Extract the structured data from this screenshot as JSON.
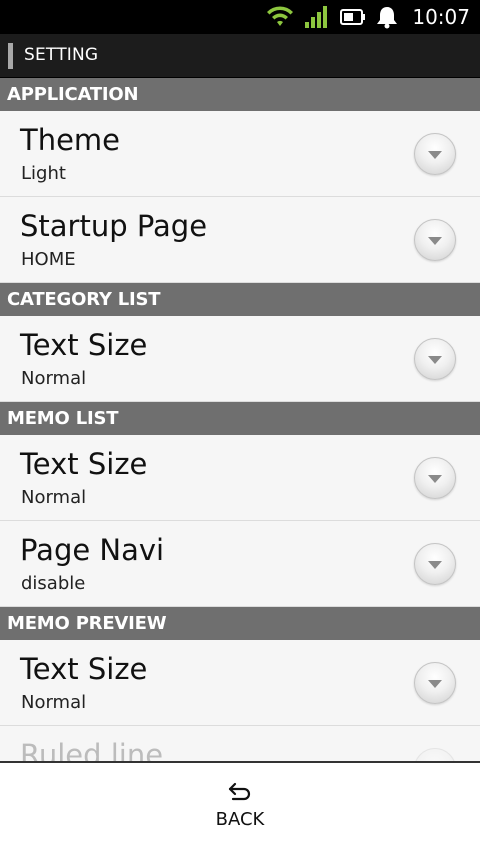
{
  "status_bar": {
    "time": "10:07",
    "icons": [
      "wifi-icon",
      "signal-icon",
      "battery-icon",
      "bell-icon"
    ],
    "wifi_color": "#8dc63f",
    "signal_color": "#8dc63f"
  },
  "header": {
    "title": "SETTING"
  },
  "sections": [
    {
      "label": "APPLICATION",
      "rows": [
        {
          "title": "Theme",
          "value": "Light"
        },
        {
          "title": "Startup Page",
          "value": "HOME"
        }
      ]
    },
    {
      "label": "CATEGORY LIST",
      "rows": [
        {
          "title": "Text Size",
          "value": "Normal"
        }
      ]
    },
    {
      "label": "MEMO LIST",
      "rows": [
        {
          "title": "Text Size",
          "value": "Normal"
        },
        {
          "title": "Page Navi",
          "value": "disable"
        }
      ]
    },
    {
      "label": "MEMO PREVIEW",
      "rows": [
        {
          "title": "Text Size",
          "value": "Normal"
        },
        {
          "title": "Ruled line",
          "value": ""
        }
      ]
    }
  ],
  "footer": {
    "back_label": "BACK"
  },
  "colors": {
    "section_header_bg": "#6f6f6f",
    "titlebar_bg": "#1c1c1c",
    "row_bg": "#f6f6f6"
  }
}
